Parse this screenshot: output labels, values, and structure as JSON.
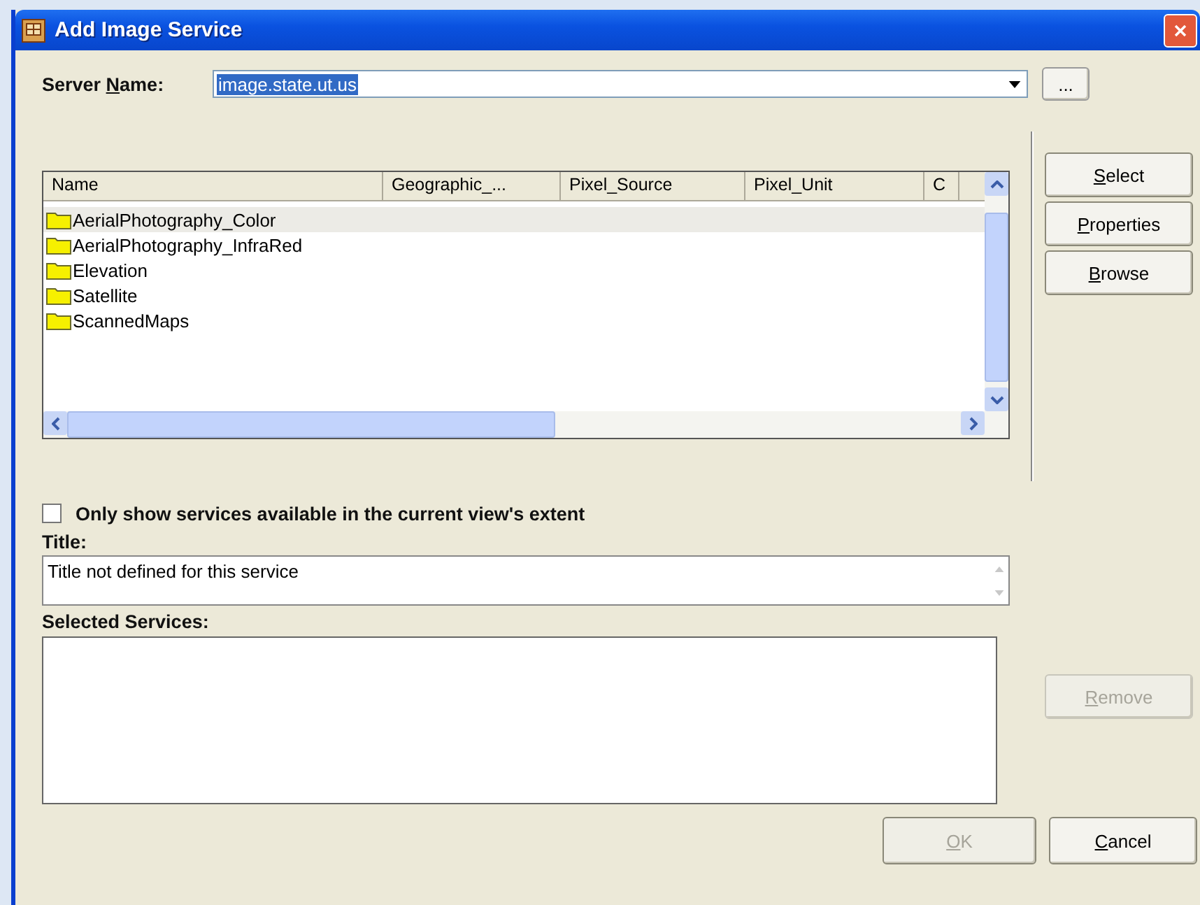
{
  "window": {
    "title": "Add Image Service"
  },
  "server": {
    "label": {
      "before": "Server ",
      "key": "N",
      "after": "ame:"
    },
    "value": "image.state.ut.us",
    "value_selected": true,
    "browse_button": "..."
  },
  "services_list": {
    "columns": [
      "Name",
      "Geographic_...",
      "Pixel_Source",
      "Pixel_Unit",
      "C"
    ],
    "rows": [
      {
        "name": "AerialPhotography_Color",
        "selected": true
      },
      {
        "name": "AerialPhotography_InfraRed",
        "selected": false
      },
      {
        "name": "Elevation",
        "selected": false
      },
      {
        "name": "Satellite",
        "selected": false
      },
      {
        "name": "ScannedMaps",
        "selected": false
      }
    ]
  },
  "side_buttons": [
    {
      "label": {
        "key": "S",
        "after": "elect"
      },
      "disabled": false
    },
    {
      "label": {
        "key": "P",
        "after": "roperties"
      },
      "disabled": false
    },
    {
      "label": {
        "key": "B",
        "after": "rowse"
      },
      "disabled": false
    }
  ],
  "extent_filter": {
    "label": "Only show services available in the current view's extent",
    "checked": false
  },
  "title_field": {
    "label": "Title:",
    "value": "Title not defined for this service"
  },
  "selected_services": {
    "label": "Selected Services:",
    "remove_button": {
      "label": {
        "key": "R",
        "after": "emove"
      },
      "disabled": true
    }
  },
  "footer_buttons": [
    {
      "label": {
        "key": "O",
        "after": "K"
      },
      "disabled": true
    },
    {
      "label": {
        "key": "C",
        "after": "ancel"
      },
      "disabled": false
    }
  ]
}
